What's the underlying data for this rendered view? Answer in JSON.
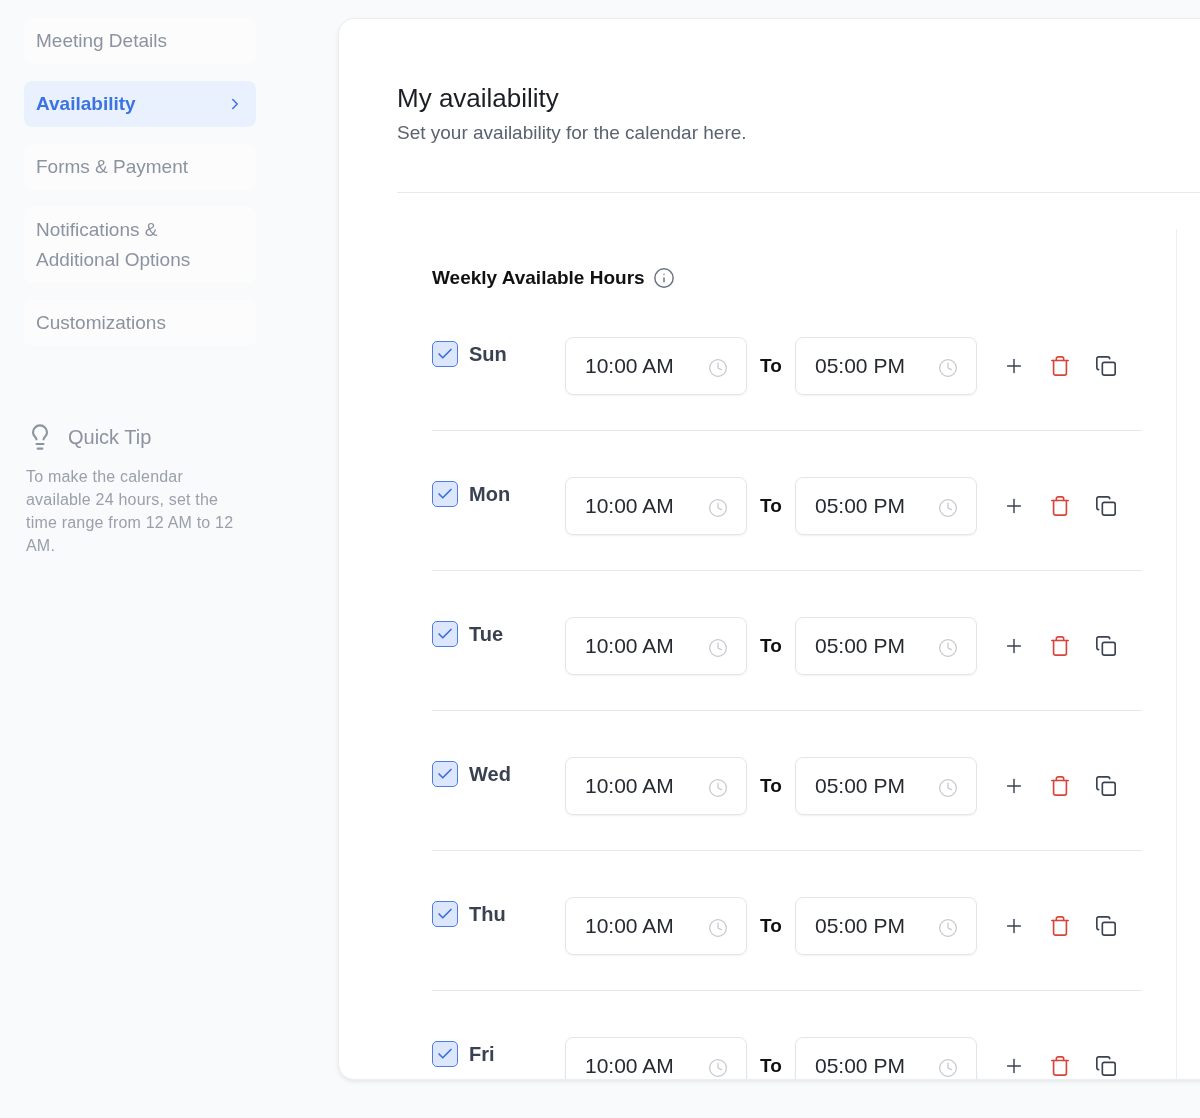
{
  "sidebar": {
    "items": [
      {
        "label": "Meeting Details",
        "selected": false
      },
      {
        "label": "Availability",
        "selected": true
      },
      {
        "label": "Forms & Payment",
        "selected": false
      },
      {
        "label": "Notifications & Additional Options",
        "selected": false
      },
      {
        "label": "Customizations",
        "selected": false
      }
    ]
  },
  "quick_tip": {
    "title": "Quick Tip",
    "text": "To make the calendar available 24 hours, set the time range from 12 AM to 12 AM."
  },
  "header": {
    "title": "My availability",
    "subtitle": "Set your availability for the calendar here."
  },
  "weekly_hours": {
    "title": "Weekly Available Hours",
    "days": [
      {
        "day": "Sun",
        "checked": true,
        "from": "10:00 AM",
        "separator": "To",
        "to": "05:00 PM"
      },
      {
        "day": "Mon",
        "checked": true,
        "from": "10:00 AM",
        "separator": "To",
        "to": "05:00 PM"
      },
      {
        "day": "Tue",
        "checked": true,
        "from": "10:00 AM",
        "separator": "To",
        "to": "05:00 PM"
      },
      {
        "day": "Wed",
        "checked": true,
        "from": "10:00 AM",
        "separator": "To",
        "to": "05:00 PM"
      },
      {
        "day": "Thu",
        "checked": true,
        "from": "10:00 AM",
        "separator": "To",
        "to": "05:00 PM"
      },
      {
        "day": "Fri",
        "checked": true,
        "from": "10:00 AM",
        "separator": "To",
        "to": "05:00 PM"
      }
    ]
  }
}
